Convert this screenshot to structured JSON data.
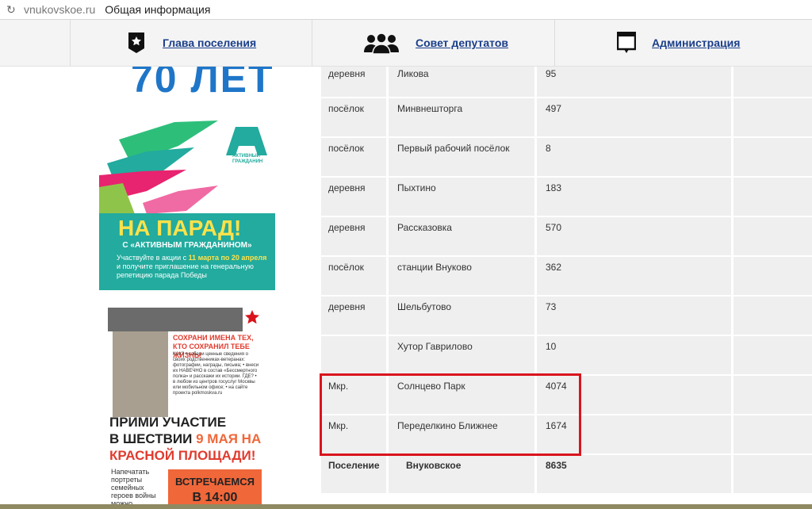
{
  "browser": {
    "domain": "vnukovskoe.ru",
    "title": "Общая информация"
  },
  "nav": [
    {
      "label": "Глава поселения",
      "icon": "shield-star-icon"
    },
    {
      "label": "Совет депутатов",
      "icon": "people-group-icon"
    },
    {
      "label": "Администрация",
      "icon": "board-icon"
    }
  ],
  "banner1": {
    "years": "70 ЛЕТ",
    "brand": "АКТИВНЫЙ ГРАЖДАНИН",
    "headline": "НА ПАРАД!",
    "subline": "С «АКТИВНЫМ ГРАЖДАНИНОМ»",
    "text_pre": "Участвуйте в акции с ",
    "text_date1": "11 марта",
    "text_mid": " ",
    "text_date2": "по 20 апреля",
    "text_post": " и получите приглашение на генеральную репетицию парада Победы"
  },
  "banner2": {
    "red": "СОХРАНИ ИМЕНА ТЕХ, КТО СОХРАНИЛ ТЕБЕ ЖИЗНЬ!",
    "small": "КАК? • собери ценные сведения о своих родственниках-ветеранах: фотографии, награды, письма; • внеси их НАВЕЧНО в состав «Бессмертного полка» и расскажи их истории. ГДЕ? • в любом из центров госуслуг Москвы или мобильном офисе; • на сайте проекта polkmoskva.ru",
    "big1": "ПРИМИ УЧАСТИЕ",
    "big2a": "В ШЕСТВИИ ",
    "big2b": "9 МАЯ НА",
    "big3": "КРАСНОЙ ПЛОЩАДИ!",
    "foot": "Напечатать портреты семейных героев войны можно самостоятельно",
    "orange1": "ВСТРЕЧАЕМСЯ",
    "orange2": "В 14:00"
  },
  "table": {
    "rows": [
      {
        "kind": "деревня",
        "name": "Ликова",
        "value": "95"
      },
      {
        "kind": "посёлок",
        "name": "Минвнешторга",
        "value": "497"
      },
      {
        "kind": "посёлок",
        "name": "Первый рабочий посёлок",
        "value": "8"
      },
      {
        "kind": "деревня",
        "name": "Пыхтино",
        "value": "183"
      },
      {
        "kind": "деревня",
        "name": "Рассказовка",
        "value": "570"
      },
      {
        "kind": "посёлок",
        "name": "станции Внуково",
        "value": "362"
      },
      {
        "kind": "деревня",
        "name": "Шельбутово",
        "value": "73"
      },
      {
        "kind": "",
        "name": "Хутор Гаврилово",
        "value": "10"
      },
      {
        "kind": "Мкр.",
        "name": "Солнцево Парк",
        "value": "4074"
      },
      {
        "kind": "Мкр.",
        "name": "Переделкино Ближнее",
        "value": "1674"
      }
    ],
    "total": {
      "kind": "Поселение",
      "name": "Внуковское",
      "value": "8635"
    }
  },
  "colors": {
    "link": "#1a3e8a",
    "highlight": "#d9141d",
    "teal": "#22ab9e",
    "cell": "#efefef"
  }
}
